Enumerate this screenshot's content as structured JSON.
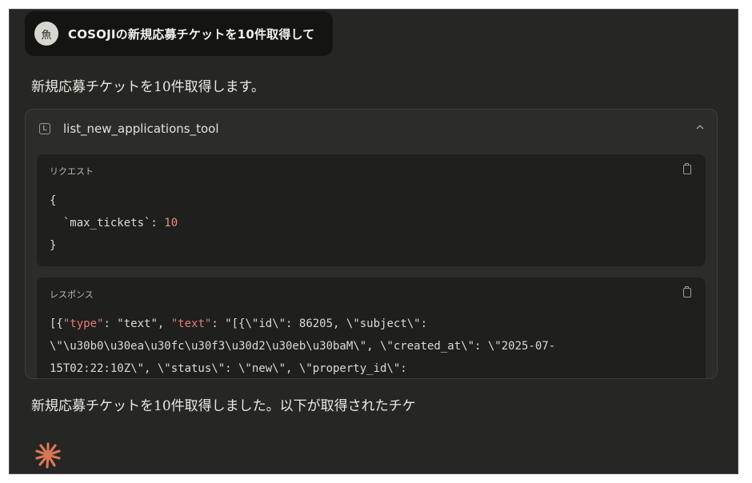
{
  "user_message": {
    "avatar_glyph": "魚",
    "text": "COSOJIの新規応募チケットを10件取得して"
  },
  "assistant": {
    "intro_text": "新規応募チケットを10件取得します。",
    "followup_text": "新規応募チケットを10件取得しました。以下が取得されたチケ"
  },
  "tool_call": {
    "icon_glyph": "L",
    "name": "list_new_applications_tool",
    "collapse_icon": "chevron-up-icon",
    "request": {
      "label": "リクエスト",
      "line1": "{",
      "line2_key": "  `max_tickets`: ",
      "line2_value": "10",
      "line3": "}"
    },
    "response": {
      "label": "レスポンス",
      "line1_a": "[{",
      "line1_key1": "\"type\"",
      "line1_b": ": \"text\", ",
      "line1_key2": "\"text\"",
      "line1_c": ": \"[{\\\"id\\\": 86205, \\\"subject\\\":",
      "line2": "\\\"\\u30b0\\u30ea\\u30fc\\u30f3\\u30d2\\u30eb\\u30baM\\\", \\\"created_at\\\": \\\"2025-07-",
      "line3": "15T02:22:10Z\\\", \\\"status\\\": \\\"new\\\", \\\"property_id\\\":"
    }
  },
  "colors": {
    "background": "#262624",
    "user_bubble": "#141413",
    "accent_spark": "#d97757"
  }
}
